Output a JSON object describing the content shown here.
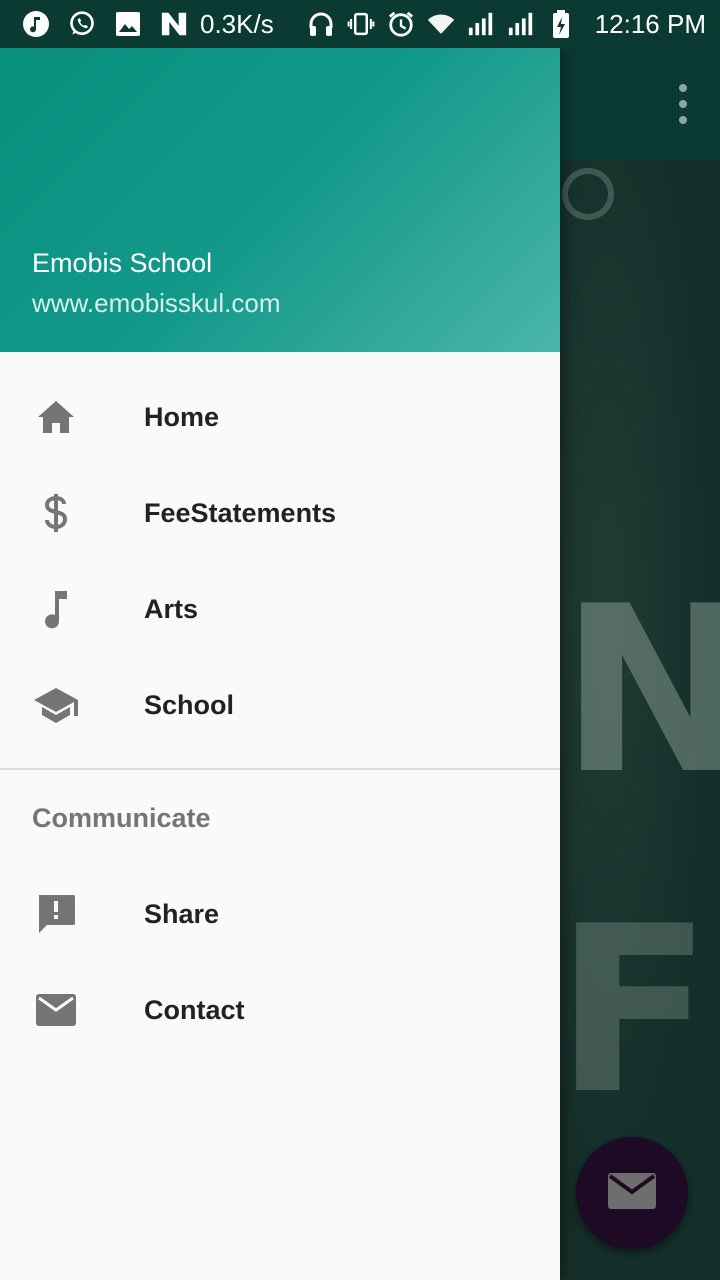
{
  "status_bar": {
    "net_speed": "0.3K/s",
    "time": "12:16 PM",
    "icons_left": [
      "music-icon",
      "whatsapp-icon",
      "image-icon",
      "n-notification-icon"
    ],
    "icons_right": [
      "headset-icon",
      "vibrate-icon",
      "alarm-icon",
      "wifi-icon",
      "signal-icon",
      "signal-icon",
      "battery-charging-icon"
    ]
  },
  "drawer": {
    "header": {
      "title": "Emobis School",
      "subtitle": "www.emobisskul.com"
    },
    "items": [
      {
        "label": "Home",
        "icon": "home-icon"
      },
      {
        "label": "FeeStatements",
        "icon": "dollar-icon"
      },
      {
        "label": "Arts",
        "icon": "music-note-icon"
      },
      {
        "label": "School",
        "icon": "school-icon"
      }
    ],
    "section": {
      "title": "Communicate",
      "items": [
        {
          "label": "Share",
          "icon": "feedback-icon"
        },
        {
          "label": "Contact",
          "icon": "mail-icon"
        }
      ]
    }
  },
  "background": {
    "chalk_text": [
      "NG",
      "F"
    ],
    "fab_icon": "mail-icon"
  },
  "colors": {
    "header_start": "#0a8f7e",
    "header_end": "#4bb5aa",
    "toolbar": "#0b3a33",
    "fab": "#1e0a24"
  }
}
